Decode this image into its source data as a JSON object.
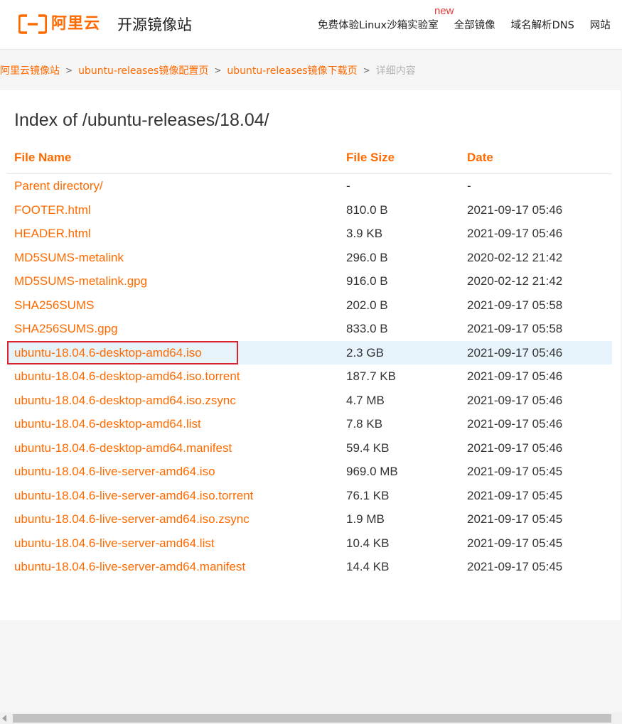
{
  "header": {
    "logo_text": "阿里云",
    "site_title": "开源镜像站",
    "nav": [
      {
        "label": "免费体验Linux沙箱实验室",
        "badge": "new"
      },
      {
        "label": "全部镜像"
      },
      {
        "label": "域名解析DNS"
      },
      {
        "label": "网站"
      }
    ]
  },
  "breadcrumb": {
    "items": [
      "阿里云镜像站",
      "ubuntu-releases镜像配置页",
      "ubuntu-releases镜像下载页"
    ],
    "current": "详细内容",
    "separator": ">"
  },
  "listing": {
    "title": "Index of /ubuntu-releases/18.04/",
    "columns": {
      "name": "File Name",
      "size": "File Size",
      "date": "Date"
    },
    "rows": [
      {
        "name": "Parent directory/",
        "size": "-",
        "date": "-"
      },
      {
        "name": "FOOTER.html",
        "size": "810.0 B",
        "date": "2021-09-17 05:46"
      },
      {
        "name": "HEADER.html",
        "size": "3.9 KB",
        "date": "2021-09-17 05:46"
      },
      {
        "name": "MD5SUMS-metalink",
        "size": "296.0 B",
        "date": "2020-02-12 21:42"
      },
      {
        "name": "MD5SUMS-metalink.gpg",
        "size": "916.0 B",
        "date": "2020-02-12 21:42"
      },
      {
        "name": "SHA256SUMS",
        "size": "202.0 B",
        "date": "2021-09-17 05:58"
      },
      {
        "name": "SHA256SUMS.gpg",
        "size": "833.0 B",
        "date": "2021-09-17 05:58"
      },
      {
        "name": "ubuntu-18.04.6-desktop-amd64.iso",
        "size": "2.3 GB",
        "date": "2021-09-17 05:46",
        "selected": true
      },
      {
        "name": "ubuntu-18.04.6-desktop-amd64.iso.torrent",
        "size": "187.7 KB",
        "date": "2021-09-17 05:46"
      },
      {
        "name": "ubuntu-18.04.6-desktop-amd64.iso.zsync",
        "size": "4.7 MB",
        "date": "2021-09-17 05:46"
      },
      {
        "name": "ubuntu-18.04.6-desktop-amd64.list",
        "size": "7.8 KB",
        "date": "2021-09-17 05:46"
      },
      {
        "name": "ubuntu-18.04.6-desktop-amd64.manifest",
        "size": "59.4 KB",
        "date": "2021-09-17 05:46"
      },
      {
        "name": "ubuntu-18.04.6-live-server-amd64.iso",
        "size": "969.0 MB",
        "date": "2021-09-17 05:45"
      },
      {
        "name": "ubuntu-18.04.6-live-server-amd64.iso.torrent",
        "size": "76.1 KB",
        "date": "2021-09-17 05:45"
      },
      {
        "name": "ubuntu-18.04.6-live-server-amd64.iso.zsync",
        "size": "1.9 MB",
        "date": "2021-09-17 05:45"
      },
      {
        "name": "ubuntu-18.04.6-live-server-amd64.list",
        "size": "10.4 KB",
        "date": "2021-09-17 05:45"
      },
      {
        "name": "ubuntu-18.04.6-live-server-amd64.manifest",
        "size": "14.4 KB",
        "date": "2021-09-17 05:45"
      }
    ]
  },
  "colors": {
    "accent": "#ff6a00",
    "selected_row": "#e6f3fb",
    "highlight_border": "#d9232d",
    "badge": "#e4393c"
  }
}
